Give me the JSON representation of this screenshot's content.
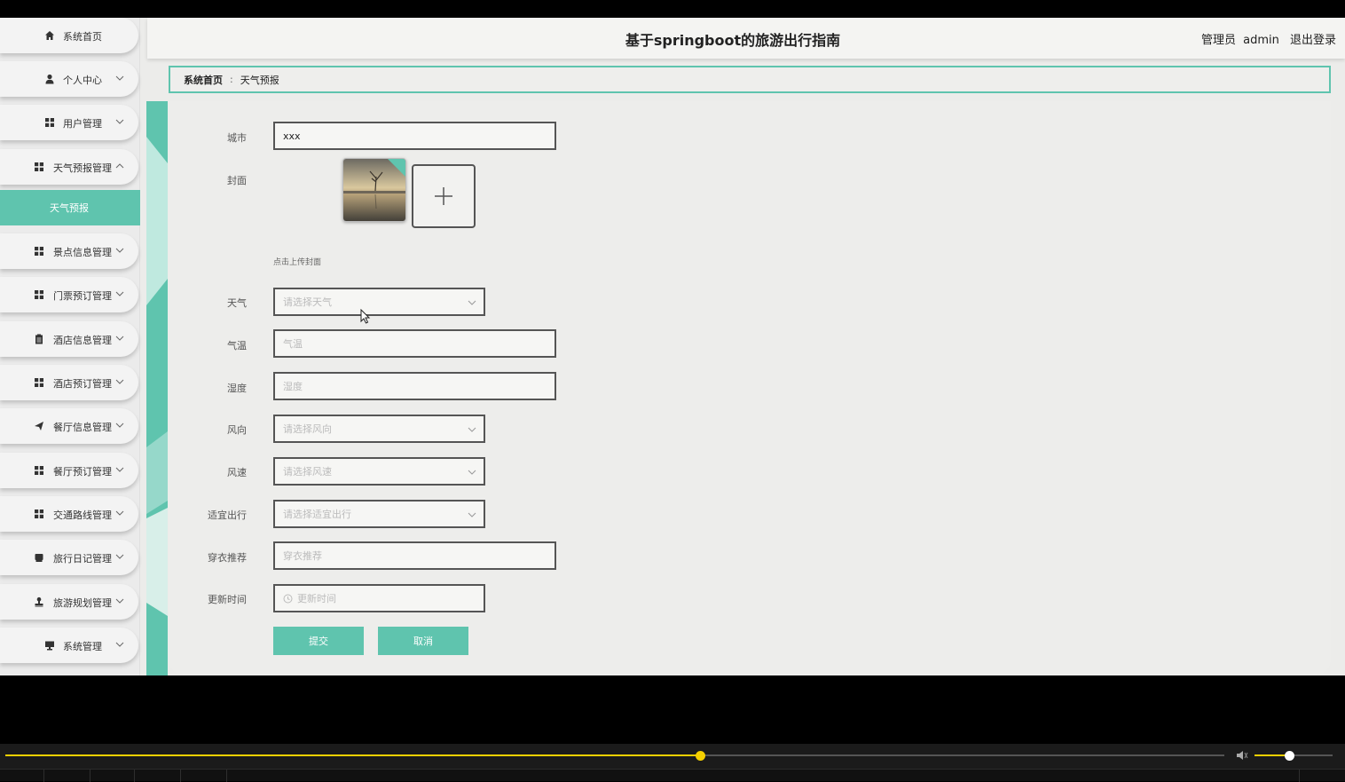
{
  "header": {
    "title": "基于springboot的旅游出行指南",
    "user_role": "管理员",
    "user_name": "admin",
    "logout_label": "退出登录"
  },
  "sidebar": {
    "items": [
      {
        "label": "系统首页",
        "icon": "home-icon",
        "expandable": false
      },
      {
        "label": "个人中心",
        "icon": "person-icon",
        "expandable": true
      },
      {
        "label": "用户管理",
        "icon": "grid-icon",
        "expandable": true
      },
      {
        "label": "天气预报管理",
        "icon": "grid-icon",
        "expandable": true,
        "expanded": true
      },
      {
        "label": "景点信息管理",
        "icon": "grid-icon",
        "expandable": true
      },
      {
        "label": "门票预订管理",
        "icon": "grid-icon",
        "expandable": true
      },
      {
        "label": "酒店信息管理",
        "icon": "clipboard-icon",
        "expandable": true
      },
      {
        "label": "酒店预订管理",
        "icon": "grid-icon",
        "expandable": true
      },
      {
        "label": "餐厅信息管理",
        "icon": "send-icon",
        "expandable": true
      },
      {
        "label": "餐厅预订管理",
        "icon": "grid-icon",
        "expandable": true
      },
      {
        "label": "交通路线管理",
        "icon": "grid-icon",
        "expandable": true
      },
      {
        "label": "旅行日记管理",
        "icon": "book-icon",
        "expandable": true
      },
      {
        "label": "旅游规划管理",
        "icon": "stamp-icon",
        "expandable": true
      },
      {
        "label": "系统管理",
        "icon": "monitor-icon",
        "expandable": true
      }
    ],
    "active_subitem": "天气预报"
  },
  "breadcrumb": {
    "home": "系统首页",
    "separator": ":",
    "current": "天气预报"
  },
  "form": {
    "city_label": "城市",
    "city_value": "xxx",
    "cover_label": "封面",
    "cover_hint": "点击上传封面",
    "weather_label": "天气",
    "weather_placeholder": "请选择天气",
    "temperature_label": "气温",
    "temperature_placeholder": "气温",
    "humidity_label": "湿度",
    "humidity_placeholder": "湿度",
    "wind_direction_label": "风向",
    "wind_direction_placeholder": "请选择风向",
    "wind_speed_label": "风速",
    "wind_speed_placeholder": "请选择风速",
    "suitable_label": "适宜出行",
    "suitable_placeholder": "请选择适宜出行",
    "clothing_label": "穿衣推荐",
    "clothing_placeholder": "穿衣推荐",
    "update_time_label": "更新时间",
    "update_time_placeholder": "更新时间",
    "submit_label": "提交",
    "cancel_label": "取消"
  },
  "player": {
    "progress": 0.57,
    "volume": 0.44
  },
  "colors": {
    "accent": "#5fc4ae",
    "player_accent": "#f5d000"
  }
}
